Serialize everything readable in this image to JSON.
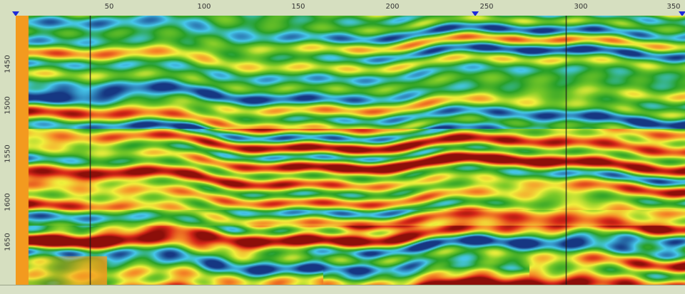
{
  "ruler": {
    "traces": [
      "50",
      "100",
      "150",
      "200",
      "250",
      "300",
      "350"
    ],
    "depths": [
      "1450",
      "1500",
      "1550",
      "1600",
      "1650"
    ]
  },
  "colors": {
    "background": "#dfe6cf",
    "ruler": "#d6dfc0",
    "marker": "#1d2ad8",
    "edge_strip": "#f39a1f",
    "cursor_line": "#1a1a1a"
  },
  "markers": {
    "icon": "triangle-down-icon",
    "traces": [
      0,
      245,
      355
    ]
  }
}
